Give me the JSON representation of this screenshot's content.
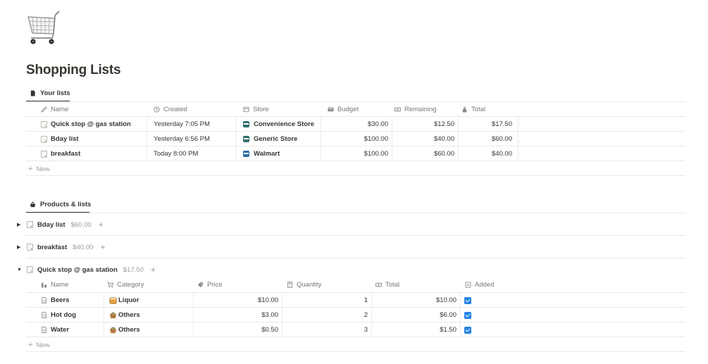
{
  "page": {
    "title": "Shopping Lists",
    "icon": "shopping-cart-icon"
  },
  "your_lists": {
    "tab_label": "Your lists",
    "columns": [
      "Name",
      "Created",
      "Store",
      "Budget",
      "Remaining",
      "Total"
    ],
    "rows": [
      {
        "name": "Quick stop @ gas station",
        "created": "Yesterday 7:05 PM",
        "store": "Convenience Store",
        "budget": "$30.00",
        "remaining": "$12.50",
        "total": "$17.50"
      },
      {
        "name": "Bday list",
        "created": "Yesterday 6:56 PM",
        "store": "Generic Store",
        "budget": "$100.00",
        "remaining": "$40.00",
        "total": "$60.00"
      },
      {
        "name": "breakfast",
        "created": "Today 8:00 PM",
        "store": "Walmart",
        "budget": "$100.00",
        "remaining": "$60.00",
        "total": "$40.00"
      }
    ],
    "new_label": "New"
  },
  "products": {
    "tab_label": "Products & lists",
    "groups": [
      {
        "name": "Bday list",
        "total": "$60.00",
        "expanded": false
      },
      {
        "name": "breakfast",
        "total": "$40.00",
        "expanded": false
      },
      {
        "name": "Quick stop @ gas station",
        "total": "$17.50",
        "expanded": true
      }
    ],
    "columns": [
      "Name",
      "Category",
      "Price",
      "Quantity",
      "Total",
      "Added"
    ],
    "rows": [
      {
        "name": "Beers",
        "category": "Liquor",
        "category_icon": "liquor-icon",
        "price": "$10.00",
        "quantity": "1",
        "total": "$10.00",
        "added": true
      },
      {
        "name": "Hot dog",
        "category": "Others",
        "category_icon": "basket-icon",
        "price": "$3.00",
        "quantity": "2",
        "total": "$6.00",
        "added": true
      },
      {
        "name": "Water",
        "category": "Others",
        "category_icon": "basket-icon",
        "price": "$0.50",
        "quantity": "3",
        "total": "$1.50",
        "added": true
      }
    ],
    "new_label": "New"
  },
  "colors": {
    "text": "#37352f",
    "muted": "#787774",
    "faint": "#9b9a97",
    "border": "#e9e9e7",
    "checkbox": "#2383e2"
  }
}
